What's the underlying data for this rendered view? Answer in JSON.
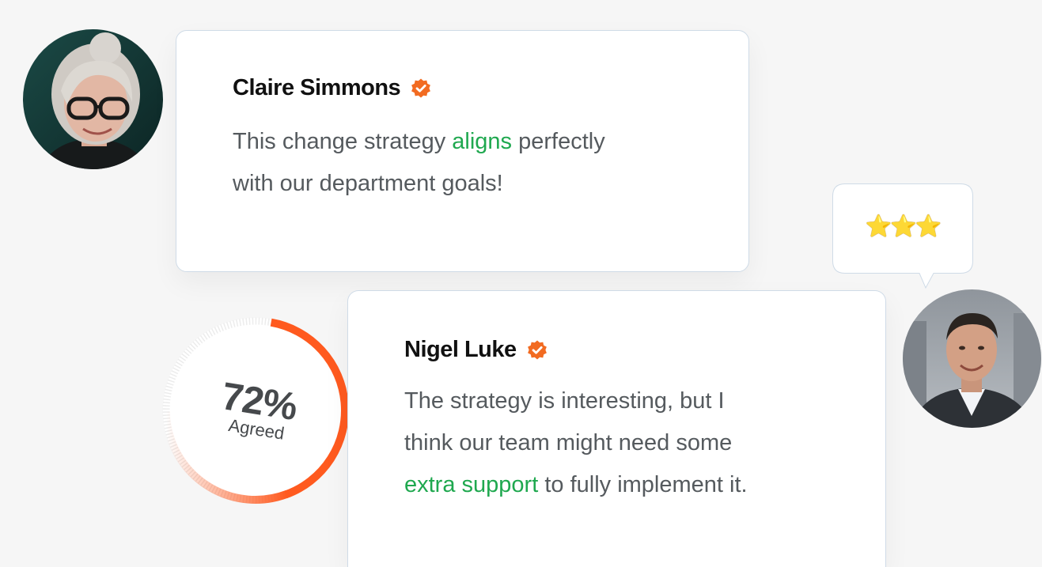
{
  "testimonials": [
    {
      "name": "Claire Simmons",
      "verified": true,
      "quote_lines": [
        {
          "before": "This change strategy ",
          "highlight": "aligns",
          "after": " perfectly"
        },
        {
          "before": "with our department goals!",
          "highlight": "",
          "after": ""
        }
      ]
    },
    {
      "name": "Nigel Luke",
      "verified": true,
      "quote_lines": [
        {
          "before": "The strategy is interesting, but I",
          "highlight": "",
          "after": ""
        },
        {
          "before": "think our team might need some",
          "highlight": "",
          "after": ""
        },
        {
          "before": "",
          "highlight": "extra support",
          "after": " to fully implement it."
        }
      ]
    }
  ],
  "rating": {
    "stars_text": "⭐⭐⭐",
    "value": 3
  },
  "agreement": {
    "value_label": "72%",
    "caption": "Agreed",
    "fraction": 0.72
  },
  "colors": {
    "accent_orange": "#ff5a1f",
    "verified_badge": "#f26b21",
    "highlight_green": "#1fa84f",
    "card_border": "#cfdbe7"
  },
  "icons": {
    "verified": "verified-badge-icon",
    "rating": "star-icon"
  }
}
